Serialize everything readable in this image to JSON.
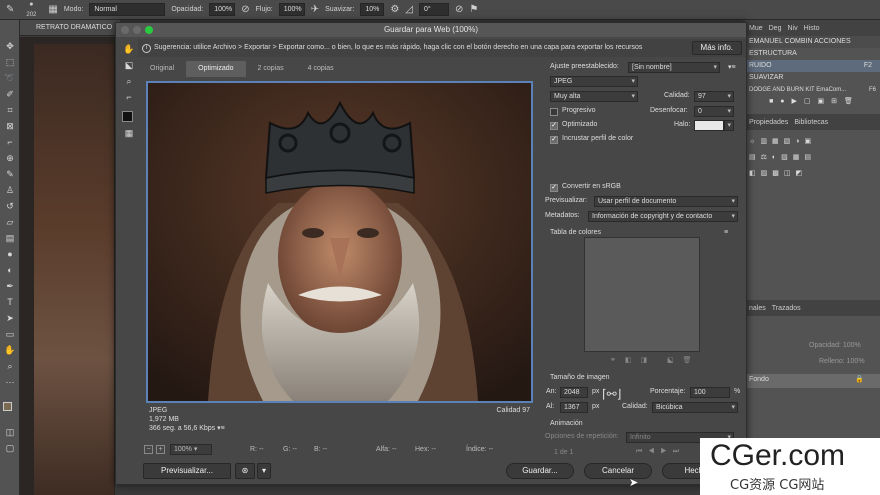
{
  "optionsbar": {
    "brush_size": "202",
    "mode_label": "Modo:",
    "mode_value": "Normal",
    "opacity_label": "Opacidad:",
    "opacity_value": "100%",
    "flow_label": "Flujo:",
    "flow_value": "100%",
    "smooth_label": "Suavizar:",
    "smooth_value": "10%",
    "angle_value": "0°"
  },
  "document": {
    "tab_title": "RETRATO DRAMATICO"
  },
  "panels": {
    "top_tabs": [
      "Mue",
      "Deg",
      "Niv",
      "Histo"
    ],
    "actions": [
      "EMANUEL COMBIN ACCIONES",
      "ESTRUCTURA",
      "RUIDO",
      "SUAVIZAR",
      "DODGE AND BURN KIT EmaCom..."
    ],
    "actions_shortcuts": [
      "",
      "",
      "F2",
      "",
      "F6"
    ],
    "mid_tabs": [
      "Propiedades",
      "Bibliotecas"
    ],
    "layers_tabs": [
      "nales",
      "Trazados"
    ],
    "opacity_label": "Opacidad:",
    "opacity_value": "100%",
    "fill_label": "Relleno:",
    "fill_value": "100%",
    "layer_name": "Fondo"
  },
  "dialog": {
    "title": "Guardar para Web (100%)",
    "hint": "Sugerencia: utilice Archivo > Exportar > Exportar como... o bien, lo que es más rápido, haga clic con el botón derecho en una capa para exportar los recursos",
    "more_info": "Más info.",
    "tabs": [
      "Original",
      "Optimizado",
      "2 copias",
      "4 copias"
    ],
    "image_info": {
      "format": "JPEG",
      "size": "1,972 MB",
      "time": "366 seg. a 56,6 Kbps",
      "quality": "Calidad 97"
    },
    "status": {
      "zoom": "100%",
      "r": "R: --",
      "g": "G: --",
      "b": "B: --",
      "alpha": "Alfa: --",
      "hex": "Hex: --",
      "index": "Índice: --"
    },
    "buttons": {
      "preview": "Previsualizar...",
      "save": "Guardar...",
      "cancel": "Cancelar",
      "done": "Hecho"
    },
    "settings": {
      "preset_label": "Ajuste preestablecido:",
      "preset_value": "[Sin nombre]",
      "format_value": "JPEG",
      "quality_preset": "Muy alta",
      "quality_label": "Calidad:",
      "quality_value": "97",
      "progressive_label": "Progresivo",
      "blur_label": "Desenfocar:",
      "blur_value": "0",
      "optimized_label": "Optimizado",
      "matte_label": "Halo:",
      "embed_label": "Incrustar perfil de color",
      "srgb_label": "Convertir en sRGB",
      "preview_label": "Previsualizar:",
      "preview_value": "Usar perfil de documento",
      "metadata_label": "Metadatos:",
      "metadata_value": "Información de copyright y de contacto",
      "color_table_label": "Tabla de colores",
      "image_size_label": "Tamaño de imagen",
      "width_label": "An:",
      "width_value": "2048",
      "height_label": "Al:",
      "height_value": "1367",
      "unit": "px",
      "percent_label": "Porcentaje:",
      "percent_value": "100",
      "percent_unit": "%",
      "quality2_label": "Calidad:",
      "quality2_value": "Bicúbica",
      "animation_label": "Animación",
      "loop_label": "Opciones de repetición:",
      "loop_value": "Infinito",
      "frame_counter": "1 de 1"
    }
  },
  "watermark": {
    "brand": "CGer.com",
    "sub": "CG资源 CG网站"
  }
}
